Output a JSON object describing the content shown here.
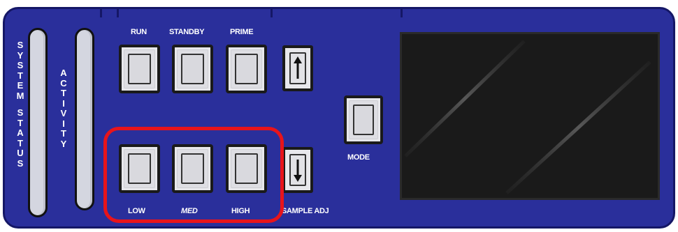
{
  "labels": {
    "system_status": "SYSTEM STATUS",
    "activity": "ACTIVITY",
    "run": "RUN",
    "standby": "STANDBY",
    "prime": "PRIME",
    "mode": "MODE",
    "low": "LOW",
    "med": "MED",
    "high": "HIGH",
    "sample_adj": "SAMPLE ADJ"
  },
  "icons": {
    "up": "arrow-up-icon",
    "down": "arrow-down-icon"
  },
  "colors": {
    "panel": "#2a2f9b",
    "highlight": "#e8141b",
    "display": "#1a1a1a"
  }
}
